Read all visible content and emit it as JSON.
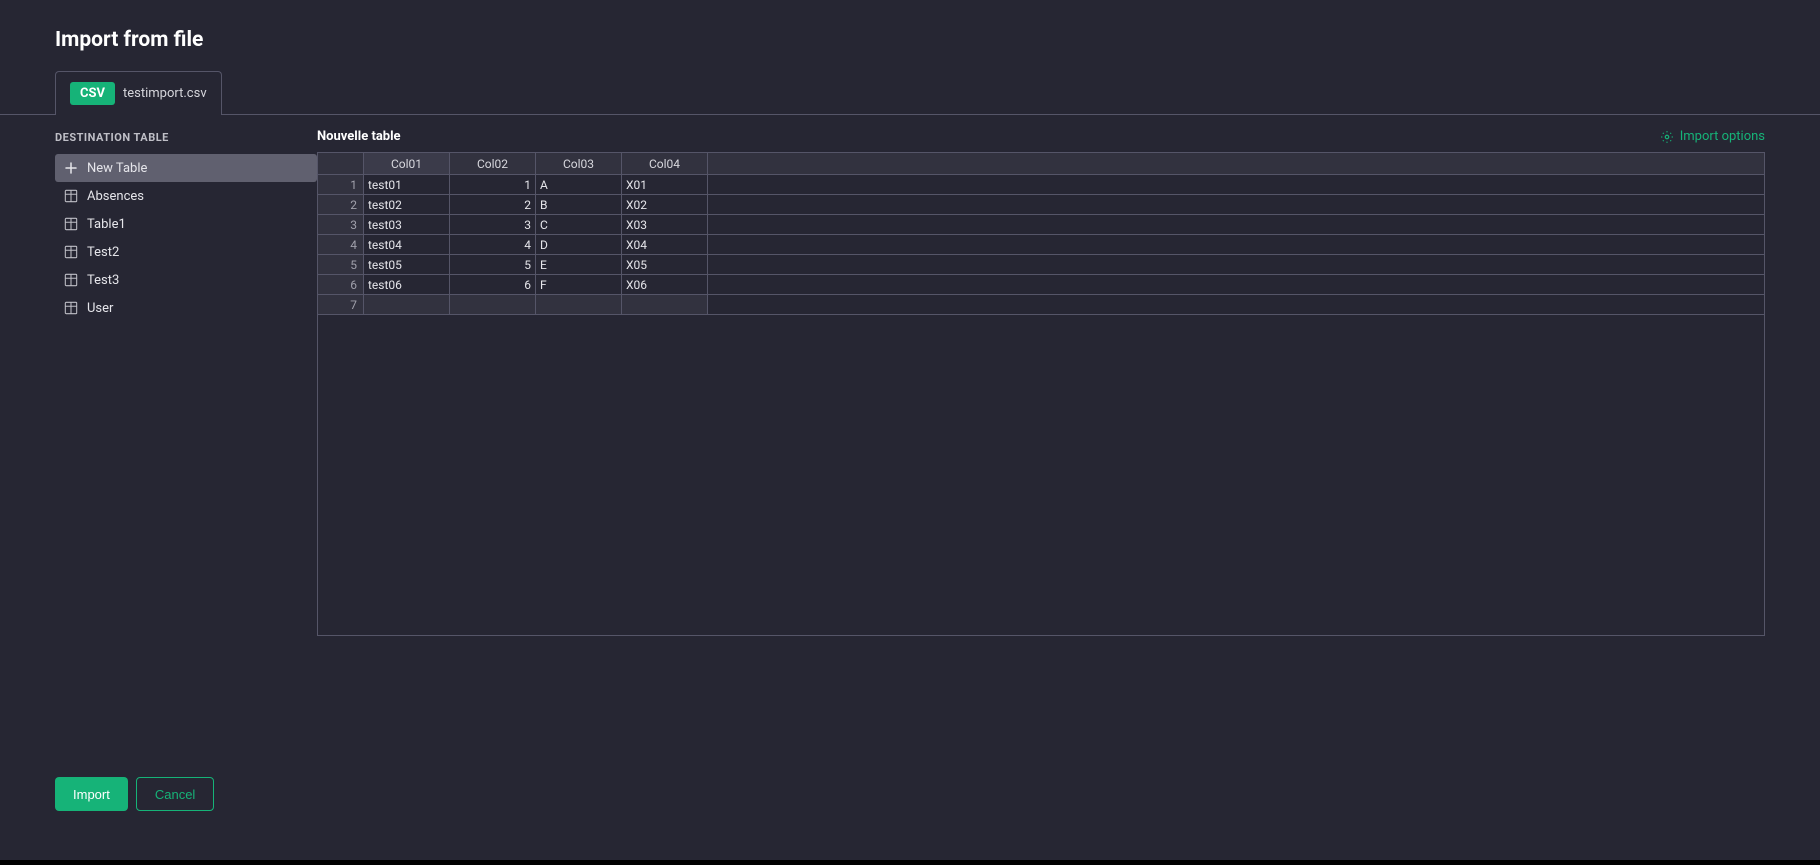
{
  "header": {
    "title": "Import from file",
    "file_type_badge": "CSV",
    "file_name": "testimport.csv"
  },
  "sidebar": {
    "heading": "DESTINATION TABLE",
    "new_table_label": "New Table",
    "items": [
      {
        "label": "Absences"
      },
      {
        "label": "Table1"
      },
      {
        "label": "Test2"
      },
      {
        "label": "Test3"
      },
      {
        "label": "User"
      }
    ]
  },
  "main": {
    "table_name": "Nouvelle table",
    "import_options_label": "Import options",
    "columns": [
      "Col01",
      "Col02",
      "Col03",
      "Col04"
    ],
    "rows": [
      {
        "n": "1",
        "c1": "test01",
        "c2": "1",
        "c3": "A",
        "c4": "X01"
      },
      {
        "n": "2",
        "c1": "test02",
        "c2": "2",
        "c3": "B",
        "c4": "X02"
      },
      {
        "n": "3",
        "c1": "test03",
        "c2": "3",
        "c3": "C",
        "c4": "X03"
      },
      {
        "n": "4",
        "c1": "test04",
        "c2": "4",
        "c3": "D",
        "c4": "X04"
      },
      {
        "n": "5",
        "c1": "test05",
        "c2": "5",
        "c3": "E",
        "c4": "X05"
      },
      {
        "n": "6",
        "c1": "test06",
        "c2": "6",
        "c3": "F",
        "c4": "X06"
      }
    ],
    "empty_row_n": "7"
  },
  "footer": {
    "import_label": "Import",
    "cancel_label": "Cancel"
  },
  "colors": {
    "accent": "#16b378",
    "bg": "#262633",
    "panel": "#32323f",
    "border": "#555568"
  }
}
